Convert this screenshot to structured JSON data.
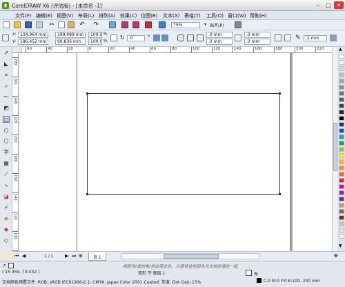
{
  "window": {
    "title": "CorelDRAW X6 (评估版) - [未命名 -1]",
    "controls": [
      "–",
      "□",
      "✕"
    ]
  },
  "menu": {
    "items": [
      "文件(F)",
      "编辑(E)",
      "视图(V)",
      "布局(L)",
      "排列(A)",
      "效果(C)",
      "位图(B)",
      "文本(X)",
      "表格(T)",
      "工具(O)",
      "窗口(W)",
      "帮助(H)"
    ]
  },
  "standard_toolbar": {
    "zoom": "75%",
    "snap_label": "贴齐(P)"
  },
  "property_bar": {
    "x": "104.964 mm",
    "y": "186.452 mm",
    "width": "189.089 mm",
    "height": "99.836 mm",
    "scale_w": "100.0",
    "scale_h": "100.0",
    "scale_unit": "%",
    "angle": ".0",
    "corner_1": ".0 mm",
    "corner_2": ".0 mm",
    "corner_3": ".0 mm",
    "corner_4": ".0 mm",
    "outline_width": ".2 mm"
  },
  "rulers": {
    "top_ticks": [
      "60",
      "40",
      "20",
      "0",
      "20",
      "40",
      "60",
      "80",
      "100",
      "120",
      "140",
      "160",
      "180",
      "200",
      "220"
    ],
    "left_ticks": [
      "280",
      "260",
      "240",
      "220",
      "200",
      "180",
      "160",
      "140",
      "120",
      "100",
      "80"
    ]
  },
  "toolbox": {
    "tools": [
      "pick-tool",
      "shape-tool",
      "crop-tool",
      "zoom-tool",
      "freehand-tool",
      "smart-fill-tool",
      "rectangle-tool",
      "ellipse-tool",
      "polygon-tool",
      "text-tool",
      "table-tool",
      "dimension-tool",
      "connector-tool",
      "interactive-tool",
      "eyedropper-tool",
      "outline-tool",
      "fill-tool",
      "interactive-fill-tool"
    ]
  },
  "palette": {
    "colors": [
      "#ffffff",
      "#f2f2f2",
      "#d9d9d9",
      "#bfbfbf",
      "#a6a6a6",
      "#8c8c8c",
      "#737373",
      "#595959",
      "#404040",
      "#262626",
      "#000000",
      "#1f2d8a",
      "#0057b8",
      "#00a0e9",
      "#00a650",
      "#8dc63f",
      "#fff200",
      "#fdb913",
      "#f7941d",
      "#f26522",
      "#ed1c24",
      "#ec008c",
      "#92278f",
      "#662d91",
      "#c69c6d",
      "#8b5e3c",
      "#603913",
      "#d4c8a8",
      "#e6e0cf",
      "#f5f1e6"
    ]
  },
  "pagebar": {
    "page_count": "1 / 1",
    "page_tab": "页 1"
  },
  "status": {
    "coords": "( 15.359, 79.032 )",
    "object_info": "矩形 于 图层 1",
    "hint": "将颜色(或对象)拖动至此处，以便将这些颜色与文档存储在一起",
    "color_profile": "文档颜色预置文件: RGB: sRGB IEC61966-2.1; CMYK: Japan Color 2001 Coated; 灰度: Dot Gain 15%",
    "fill": "无",
    "outline": "C:0 M:0 Y:0 K:100  .200 mm"
  },
  "accent_colors": {
    "menubar": "#dfe7f1",
    "toolbar": "#e9eef4"
  }
}
